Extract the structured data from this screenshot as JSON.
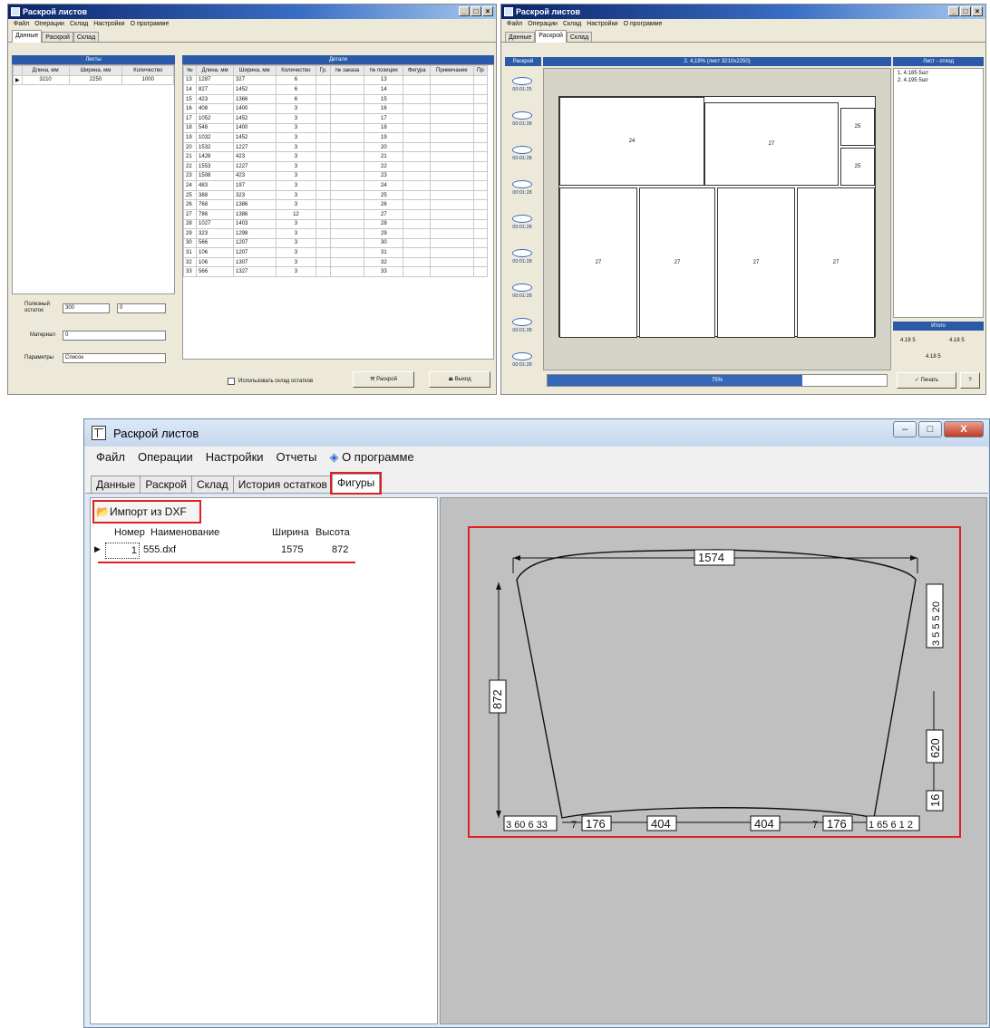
{
  "win1": {
    "title": "Раскрой листов",
    "controls": [
      "_",
      "□",
      "×"
    ],
    "menu": [
      "Файл",
      "Операции",
      "Склад",
      "Настройки",
      "О программе"
    ],
    "tabs": [
      "Данные",
      "Раскрой",
      "Склад"
    ],
    "sheets_header": "Листы",
    "details_header": "Детали",
    "sheet_cols": [
      "Длина, мм",
      "Ширина, мм",
      "Количество"
    ],
    "sheet_row": [
      "3210",
      "2250",
      "1000"
    ],
    "detail_cols": [
      "№",
      "Длина, мм",
      "Ширина, мм",
      "Количество",
      "Гр.",
      "№ заказа",
      "№ позиции",
      "Фигура",
      "Примечание",
      "Пр"
    ],
    "detail_rows": [
      [
        "13",
        "1287",
        "327",
        "6",
        "13"
      ],
      [
        "14",
        "827",
        "1452",
        "6",
        "14"
      ],
      [
        "15",
        "423",
        "1366",
        "6",
        "15"
      ],
      [
        "16",
        "408",
        "1400",
        "3",
        "16"
      ],
      [
        "17",
        "1052",
        "1452",
        "3",
        "17"
      ],
      [
        "18",
        "548",
        "1400",
        "3",
        "18"
      ],
      [
        "19",
        "1032",
        "1452",
        "3",
        "19"
      ],
      [
        "20",
        "1532",
        "1227",
        "3",
        "20"
      ],
      [
        "21",
        "1428",
        "423",
        "3",
        "21"
      ],
      [
        "22",
        "1553",
        "1227",
        "3",
        "22"
      ],
      [
        "23",
        "1508",
        "423",
        "3",
        "23"
      ],
      [
        "24",
        "483",
        "197",
        "3",
        "24"
      ],
      [
        "25",
        "388",
        "323",
        "3",
        "25"
      ],
      [
        "26",
        "768",
        "1386",
        "3",
        "26"
      ],
      [
        "27",
        "786",
        "1386",
        "12",
        "27"
      ],
      [
        "28",
        "1027",
        "1403",
        "3",
        "28"
      ],
      [
        "29",
        "323",
        "1298",
        "3",
        "29"
      ],
      [
        "30",
        "566",
        "1207",
        "3",
        "30"
      ],
      [
        "31",
        "106",
        "1207",
        "3",
        "31"
      ],
      [
        "32",
        "106",
        "1307",
        "3",
        "32"
      ],
      [
        "33",
        "566",
        "1327",
        "3",
        "33"
      ]
    ],
    "remainder_label": "Полезный остаток",
    "remainder_a": "300",
    "remainder_b": "0",
    "material_label": "Материал",
    "material_value": "0",
    "params_label": "Параметры",
    "params_value": "Список",
    "use_stock_label": "Использовать склад остатков",
    "cut_btn": "Раскрой",
    "exit_btn": "Выход"
  },
  "win2": {
    "title": "Раскрой листов",
    "controls": [
      "_",
      "□",
      "×"
    ],
    "menu": [
      "Файл",
      "Операции",
      "Склад",
      "Настройки",
      "О программе"
    ],
    "tabs": [
      "Данные",
      "Раскрой",
      "Склад"
    ],
    "col_left": "Раскрой",
    "col_mid": "2. 4,19% (лист 3210x2250)",
    "col_right": "Лист - отход",
    "right_list": [
      "1. 4.185 5шт",
      "2. 4.195 5шт"
    ],
    "thumb_times": [
      "00:01:25",
      "00:01:28",
      "00:01:28",
      "00:01:28",
      "00:01:28",
      "00:01:28",
      "00:01:28",
      "00:01:28",
      "00:01:28"
    ],
    "pieces_top": [
      "24",
      "27",
      "25",
      "25"
    ],
    "pieces_bottom": [
      "27",
      "27",
      "27",
      "27"
    ],
    "summary_label": "Итого",
    "summary_a": "4.18 5",
    "summary_b": "4.18 5",
    "summary_c": "4.18 5",
    "progress_label": "75%",
    "progress": 0.75,
    "print_btn": "Печать"
  },
  "win3": {
    "title": "Раскрой листов",
    "controls": [
      "–",
      "□",
      "X"
    ],
    "menu": [
      "Файл",
      "Операции",
      "Настройки",
      "Отчеты",
      "О программе"
    ],
    "tabs": [
      "Данные",
      "Раскрой",
      "Склад",
      "История остатков",
      "Фигуры"
    ],
    "import_btn": "Импорт из DXF",
    "cols": [
      "Номер",
      "Наименование",
      "Ширина",
      "Высота"
    ],
    "row": [
      "1",
      "555.dxf",
      "1575",
      "872"
    ],
    "dims": {
      "top": "1574",
      "left": "872",
      "right_mid": "620",
      "right_top": "3 5 5 5 20",
      "right_bot": "16",
      "bottom_a": "176",
      "bottom_b": "404",
      "bottom_c": "404",
      "bottom_d": "176",
      "bottom_left": "3 60 6 33",
      "bottom_right": "1 65 6 1 2",
      "small_left": "7",
      "small_right": "7"
    },
    "colors": {
      "highlight": "#e02020",
      "canvas": "#c0c0c0",
      "accent": "#2b5ba8"
    }
  }
}
